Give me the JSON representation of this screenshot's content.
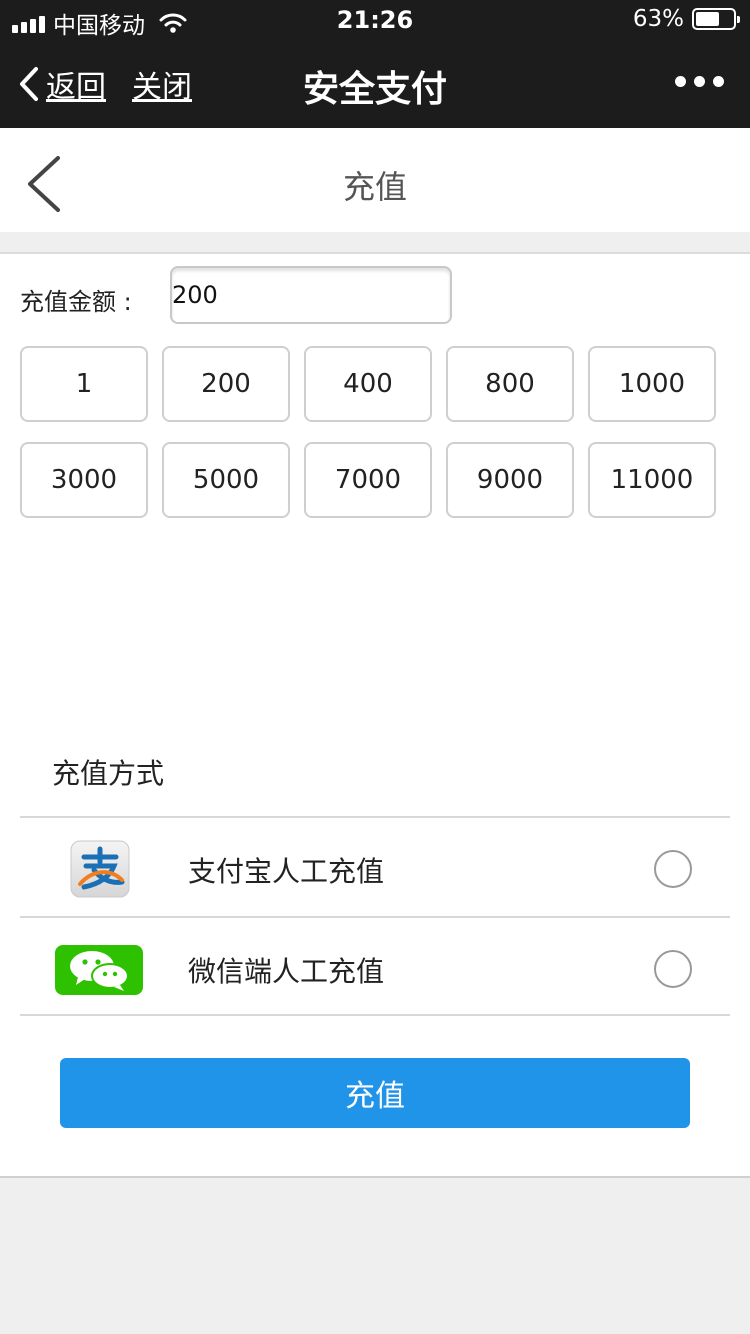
{
  "status_bar": {
    "carrier": "中国移动",
    "time": "21:26",
    "battery": "63%",
    "battery_level": 0.63
  },
  "wechat_bar": {
    "back_label": "返回",
    "close_label": "关闭",
    "title": "安全支付"
  },
  "page": {
    "title": "充值"
  },
  "recharge": {
    "amount_label": "充值金额 :",
    "amount_value": "200",
    "amounts": [
      "1",
      "200",
      "400",
      "800",
      "1000",
      "3000",
      "5000",
      "7000",
      "9000",
      "11000"
    ]
  },
  "methods": {
    "title": "充值方式",
    "items": [
      {
        "label": "支付宝人工充值",
        "icon": "alipay-icon",
        "selected": false
      },
      {
        "label": "微信端人工充值",
        "icon": "wechat-pay-icon",
        "selected": false
      }
    ]
  },
  "submit_label": "充值",
  "colors": {
    "accent": "#2094e9",
    "topbar": "#1c1c1c",
    "wechat_green": "#2dc100"
  }
}
